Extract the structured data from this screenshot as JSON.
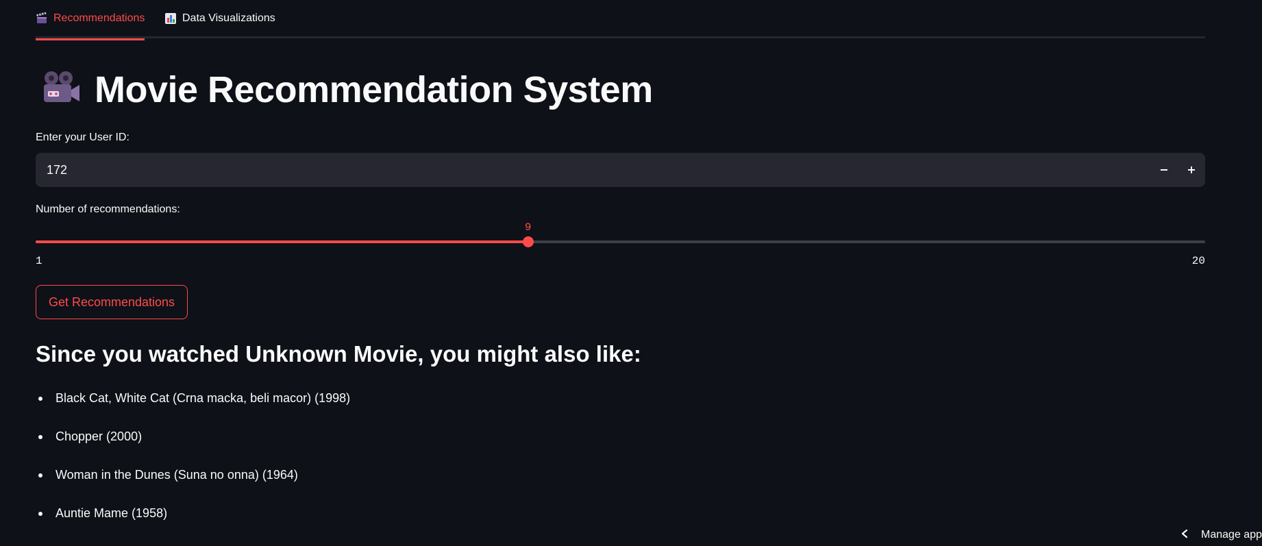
{
  "tabs": [
    {
      "label": "Recommendations",
      "icon": "clapper-board-icon",
      "active": true
    },
    {
      "label": "Data Visualizations",
      "icon": "bar-chart-icon",
      "active": false
    }
  ],
  "title": {
    "icon": "movie-camera-icon",
    "text": "Movie Recommendation System"
  },
  "user_id": {
    "label": "Enter your User ID:",
    "value": "172"
  },
  "num_recs": {
    "label": "Number of recommendations:",
    "value": "9",
    "min": "1",
    "max": "20"
  },
  "button": {
    "label": "Get Recommendations"
  },
  "results": {
    "heading": "Since you watched Unknown Movie, you might also like:",
    "items": [
      "Black Cat, White Cat (Crna macka, beli macor) (1998)",
      "Chopper (2000)",
      "Woman in the Dunes (Suna no onna) (1964)",
      "Auntie Mame (1958)"
    ]
  },
  "footer": {
    "manage_label": "Manage app"
  },
  "colors": {
    "accent": "#ff4b4b",
    "background": "#0e1117",
    "input_bg": "#262730"
  }
}
